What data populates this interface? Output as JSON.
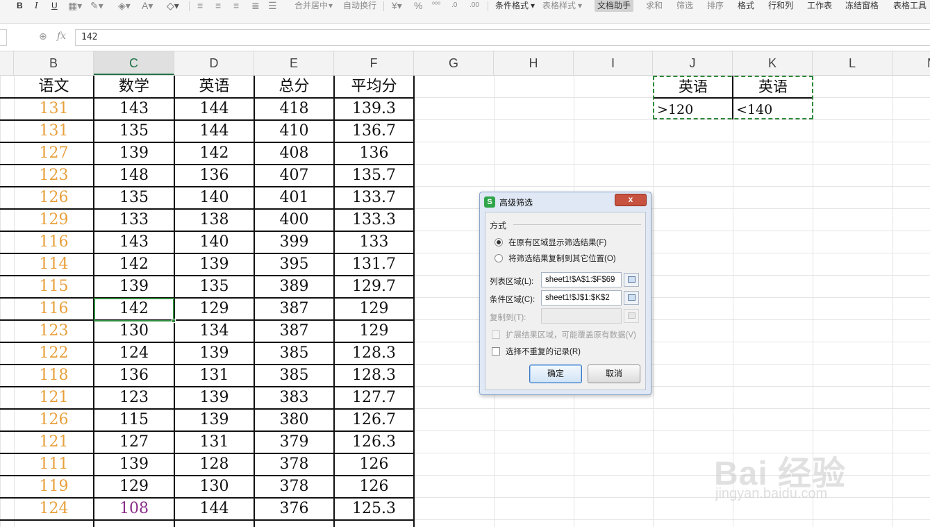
{
  "ribbon": {
    "font_bold": "B",
    "font_italic": "I",
    "font_underline": "U",
    "merge_center": "合并居中",
    "wrap_text": "自动换行",
    "percent": "%",
    "conditional_format": "条件格式",
    "table_style": "表格样式",
    "doc_assistant": "文档助手",
    "sum": "求和",
    "filter": "筛选",
    "sort": "排序",
    "format": "格式",
    "row_col": "行和列",
    "worksheet": "工作表",
    "freeze": "冻结窗格",
    "table_tools": "表格工具"
  },
  "formula_bar": {
    "fx": "fx",
    "value": "142"
  },
  "columns": [
    "B",
    "C",
    "D",
    "E",
    "F",
    "G",
    "H",
    "I",
    "J",
    "K",
    "L",
    "M"
  ],
  "table": {
    "headers": [
      "语文",
      "数学",
      "英语",
      "总分",
      "平均分"
    ],
    "rows": [
      [
        "131",
        "143",
        "144",
        "418",
        "139.3"
      ],
      [
        "131",
        "135",
        "144",
        "410",
        "136.7"
      ],
      [
        "127",
        "139",
        "142",
        "408",
        "136"
      ],
      [
        "123",
        "148",
        "136",
        "407",
        "135.7"
      ],
      [
        "126",
        "135",
        "140",
        "401",
        "133.7"
      ],
      [
        "129",
        "133",
        "138",
        "400",
        "133.3"
      ],
      [
        "116",
        "143",
        "140",
        "399",
        "133"
      ],
      [
        "114",
        "142",
        "139",
        "395",
        "131.7"
      ],
      [
        "115",
        "139",
        "135",
        "389",
        "129.7"
      ],
      [
        "116",
        "142",
        "129",
        "387",
        "129"
      ],
      [
        "123",
        "130",
        "134",
        "387",
        "129"
      ],
      [
        "122",
        "124",
        "139",
        "385",
        "128.3"
      ],
      [
        "118",
        "136",
        "131",
        "385",
        "128.3"
      ],
      [
        "121",
        "123",
        "139",
        "383",
        "127.7"
      ],
      [
        "126",
        "115",
        "139",
        "380",
        "126.7"
      ],
      [
        "121",
        "127",
        "131",
        "379",
        "126.3"
      ],
      [
        "111",
        "139",
        "128",
        "378",
        "126"
      ],
      [
        "119",
        "129",
        "130",
        "378",
        "126"
      ],
      [
        "124",
        "108",
        "144",
        "376",
        "125.3"
      ]
    ]
  },
  "criteria": {
    "headers": [
      "英语",
      "英语"
    ],
    "values": [
      ">120",
      "<140"
    ]
  },
  "dialog": {
    "title": "高级筛选",
    "group_label": "方式",
    "option_in_place": "在原有区域显示筛选结果(F)",
    "option_copy": "将筛选结果复制到其它位置(O)",
    "list_range_label": "列表区域(L):",
    "list_range_value": "sheet1!$A$1:$F$69",
    "criteria_range_label": "条件区域(C):",
    "criteria_range_value": "sheet1!$J$1:$K$2",
    "copy_to_label": "复制到(T):",
    "copy_to_value": "",
    "expand_label": "扩展结果区域，可能覆盖原有数据(V)",
    "unique_label": "选择不重复的记录(R)",
    "ok": "确定",
    "cancel": "取消",
    "close": "x"
  },
  "watermark": {
    "brand": "Bai 经验",
    "url": "jingyan.baidu.com"
  },
  "colors": {
    "accent_green": "#2f8a3c",
    "score_orange": "#e8a03c",
    "score_purple": "#8a2c8a",
    "close_red": "#c7523f"
  }
}
